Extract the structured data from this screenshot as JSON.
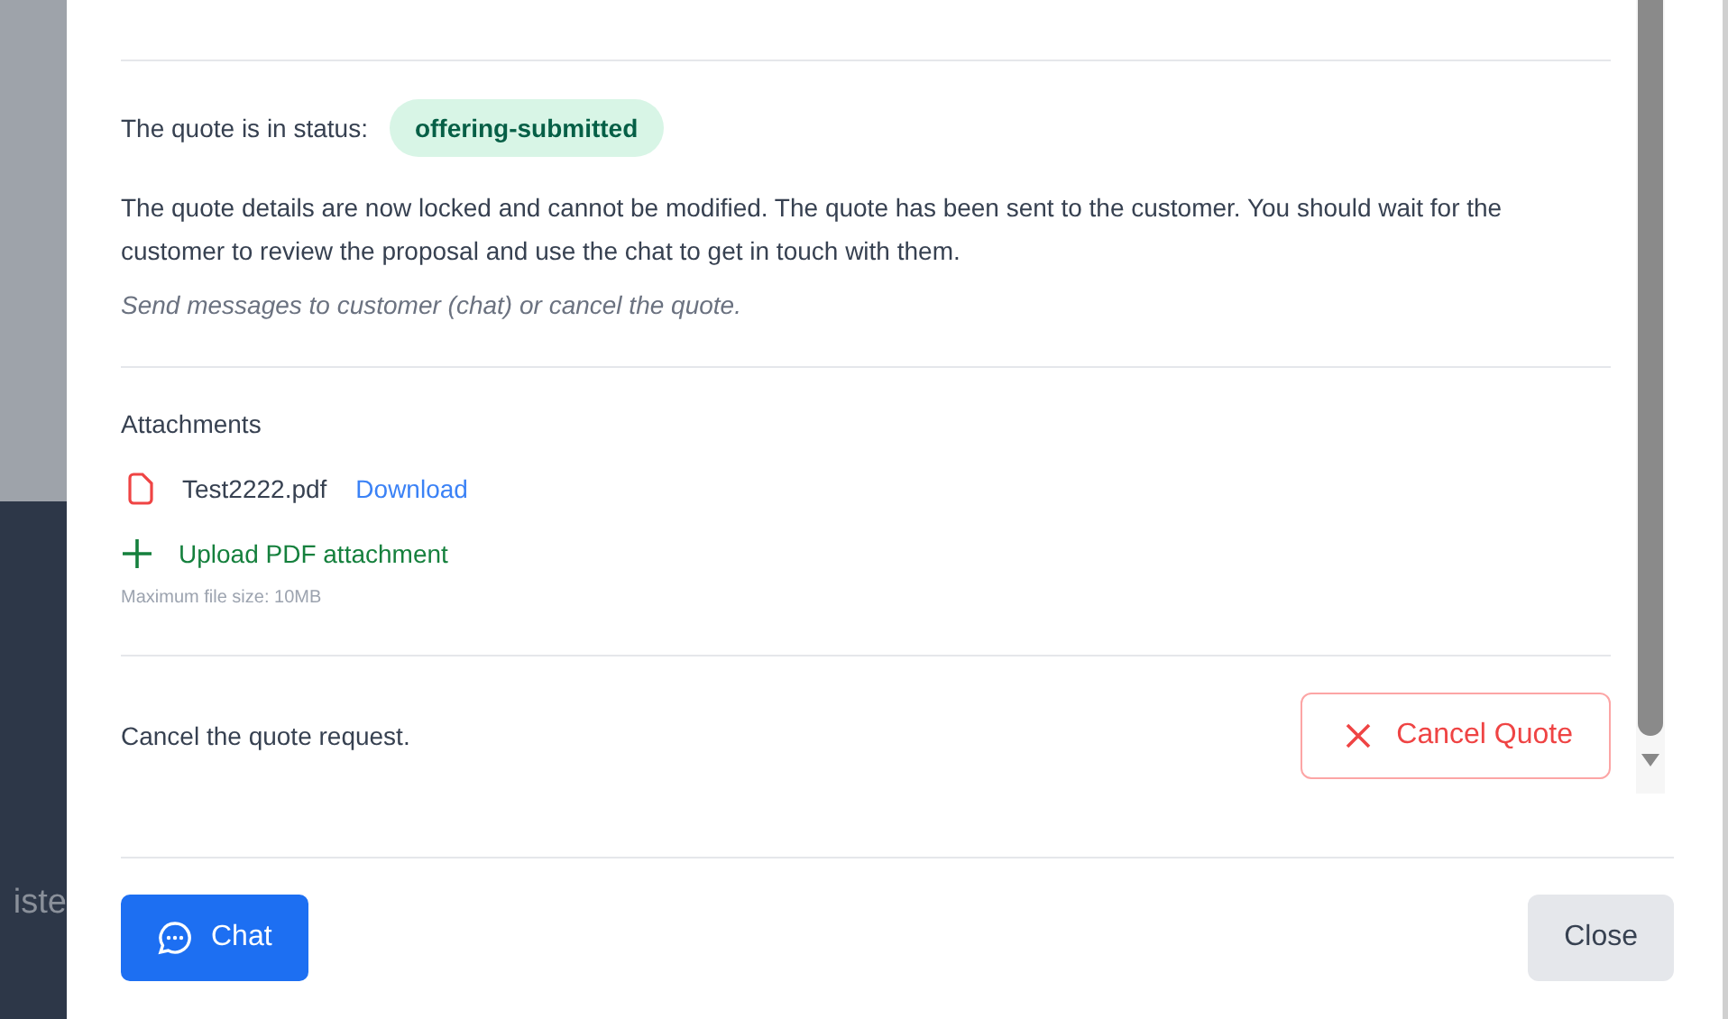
{
  "backdrop": {
    "partial_text": "iste"
  },
  "status": {
    "label": "The quote is in status:",
    "badge": "offering-submitted"
  },
  "description": "The quote details are now locked and cannot be modified. The quote has been sent to the customer. You should wait for the customer to review the proposal and use the chat to get in touch with them.",
  "hint": "Send messages to customer (chat) or cancel the quote.",
  "attachments": {
    "title": "Attachments",
    "files": [
      {
        "name": "Test2222.pdf",
        "action": "Download"
      }
    ],
    "upload": "Upload PDF attachment",
    "max_size": "Maximum file size: 10MB"
  },
  "cancel": {
    "text": "Cancel the quote request.",
    "button": "Cancel Quote"
  },
  "footer": {
    "chat": "Chat",
    "close": "Close"
  }
}
